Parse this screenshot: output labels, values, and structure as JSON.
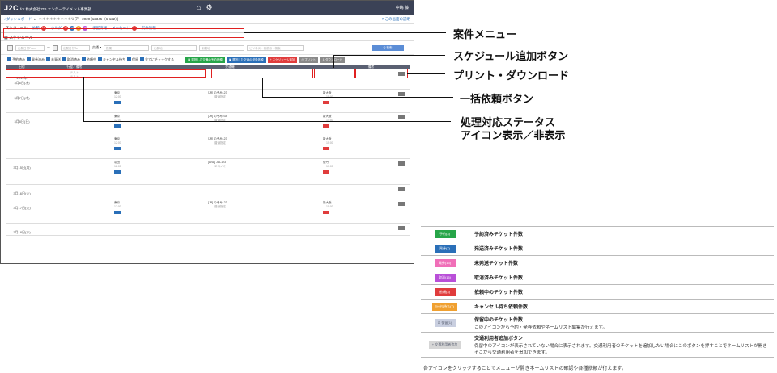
{
  "header": {
    "logo": "J2C",
    "company": "for 株式会社JTB エンターテイメント事業部",
    "user": "中嶋 藤"
  },
  "breadcrumb": {
    "home": "ダッシュボード",
    "case": "＊＊＊＊＊＊＊＊＊ツアー2020 [12345（6-122）]",
    "help": "この画面の説明"
  },
  "tabs": [
    {
      "label": "スケジュール",
      "badges": []
    },
    {
      "label": "依頼",
      "badges": [
        "15"
      ]
    },
    {
      "label": "ホルダ",
      "badges": [
        "21",
        "19",
        "8",
        "16"
      ]
    },
    {
      "label": "手配情報",
      "badges": []
    },
    {
      "label": "メッセージ",
      "badges": [
        "1"
      ]
    },
    {
      "label": "案件情報",
      "badges": []
    }
  ],
  "section_title": "スケジュール",
  "search": {
    "from_placeholder": "出発日付From",
    "to_placeholder": "出発日付To",
    "transport_label": "交通 ▾",
    "field1": "搭乗",
    "field2": "出発地",
    "field3": "到着地",
    "field4": "ビジネス・名前系・検索",
    "button": "Q 検索"
  },
  "filters": [
    "予約済み",
    "発券済み",
    "未発送",
    "取消済み",
    "依頼中",
    "キャンセル待ち",
    "保留",
    "全てにチェックする"
  ],
  "actions": {
    "bulk_reserve": "選択した交通の予約依頼",
    "bulk_issue": "選択した交通の発券依頼",
    "add_schedule": "+ スケジュール追加",
    "print": "プリント",
    "download": "ダウンロード"
  },
  "table": {
    "headers": [
      "日付",
      "行程／備考",
      "交通機",
      "備考"
    ],
    "rows": [
      {
        "date": "2019年\n3月6日(水)",
        "itinerary": "テスト\nテスト",
        "trips": []
      },
      {
        "date": "3月7日(木)",
        "itinerary": "",
        "trips": [
          {
            "from": "東京",
            "train": "[JR] のぞみ123",
            "class": "普通指定",
            "to": "新大阪",
            "dep": "12:00",
            "arr": "15:00"
          }
        ]
      },
      {
        "date": "3月8日(日)",
        "itinerary": "",
        "trips": [
          {
            "from": "東京",
            "train": "[JR] のぞみ234",
            "class": "普通指定",
            "to": "新大阪",
            "dep": "12:00",
            "arr": "14:50"
          },
          {
            "from": "東京",
            "train": "[JR] のぞみ123",
            "class": "普通指定",
            "to": "新大阪",
            "dep": "12:00",
            "arr": "15:00"
          }
        ]
      },
      {
        "date": "3月15日(月)",
        "itinerary": "",
        "trips": [
          {
            "from": "羽田",
            "train": "[ANA] JAL123",
            "class": "エコノミー",
            "to": "伊丹",
            "dep": "12:00",
            "arr": "13:00"
          }
        ]
      },
      {
        "date": "3月16日(火)",
        "itinerary": "",
        "trips": []
      },
      {
        "date": "3月17日(火)",
        "itinerary": "",
        "trips": [
          {
            "from": "東京",
            "train": "[JR] のぞみ123",
            "class": "普通指定",
            "to": "新大阪",
            "dep": "12:00",
            "arr": "15:00"
          }
        ]
      },
      {
        "date": "3月18日(水)",
        "itinerary": "",
        "trips": []
      }
    ]
  },
  "callouts": {
    "menu": "案件メニュー",
    "add_schedule": "スケジュール追加ボタン",
    "print_download": "プリント・ダウンロード",
    "bulk": "一括依頼ボタン",
    "status_line1": "処理対応ステータス",
    "status_line2": "アイコン表示／非表示"
  },
  "legend": [
    {
      "icon": "予約(3)",
      "color": "#26a548",
      "title": "予約済みチケット件数",
      "desc": ""
    },
    {
      "icon": "発券(7)",
      "color": "#2a6fb8",
      "title": "発送済みチケット件数",
      "desc": ""
    },
    {
      "icon": "発券(13)",
      "color": "#f06fb8",
      "title": "未発送チケット件数",
      "desc": ""
    },
    {
      "icon": "取消(15)",
      "color": "#b94fd8",
      "title": "取消済みチケット件数",
      "desc": ""
    },
    {
      "icon": "依頼(3)",
      "color": "#e03c3c",
      "title": "依頼中のチケット件数",
      "desc": ""
    },
    {
      "icon": "ｷｬﾝｾﾙ待ち(7)",
      "color": "#f0a030",
      "title": "キャンセル待ち依頼件数",
      "desc": ""
    },
    {
      "icon": "☑ 保留(1)",
      "color": "#c9cfe0",
      "title": "保留中のチケット件数",
      "desc": "このアイコンから予約・発券依頼やネームリスト編集が行えます。"
    },
    {
      "icon": "+ 交通利用者追加",
      "color": "#d6d6d6",
      "title": "交通利用者追加ボタン",
      "desc": "保留中のアイコンが表示されていない場合に表示されます。交通利用者のチケットを追加したい場合にこのボタンを押すことでネームリストが開きそこから交通利用者を追加できます。"
    }
  ],
  "footnote": "各アイコンをクリックすることでメニューが開きネームリストの確認や各種依頼が行えます。"
}
